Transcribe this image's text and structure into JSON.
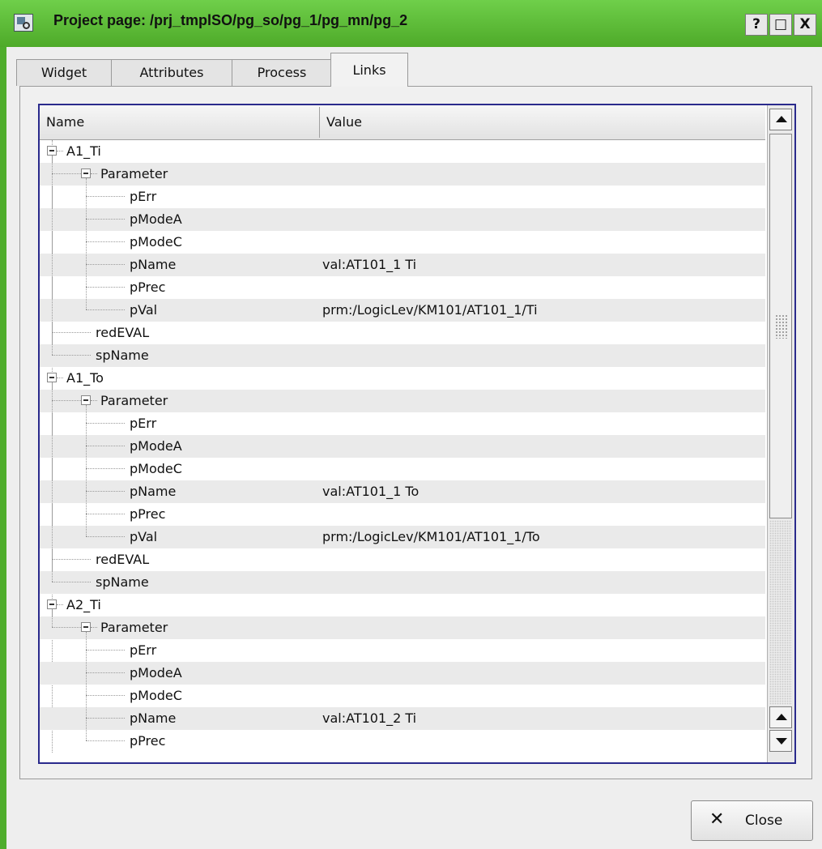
{
  "window": {
    "title": "Project page: /prj_tmplSO/pg_so/pg_1/pg_mn/pg_2"
  },
  "titlebar_buttons": [
    "?",
    "□",
    "X"
  ],
  "tabs": [
    {
      "label": "Widget"
    },
    {
      "label": "Attributes"
    },
    {
      "label": "Process"
    },
    {
      "label": "Links",
      "active": true
    }
  ],
  "tree": {
    "columns": [
      "Name",
      "Value"
    ],
    "rows": [
      {
        "name": "A1_Ti",
        "value": "",
        "level": 0,
        "kind": "node"
      },
      {
        "name": "Parameter",
        "value": "",
        "level": 1,
        "kind": "node"
      },
      {
        "name": "pErr",
        "value": "",
        "level": 2,
        "kind": "leaf"
      },
      {
        "name": "pModeA",
        "value": "",
        "level": 2,
        "kind": "leaf"
      },
      {
        "name": "pModeC",
        "value": "",
        "level": 2,
        "kind": "leaf"
      },
      {
        "name": "pName",
        "value": "val:AT101_1 Ti",
        "level": 2,
        "kind": "leaf"
      },
      {
        "name": "pPrec",
        "value": "",
        "level": 2,
        "kind": "leaf"
      },
      {
        "name": "pVal",
        "value": "prm:/LogicLev/KM101/AT101_1/Ti",
        "level": 2,
        "kind": "leaf"
      },
      {
        "name": "redEVAL",
        "value": "",
        "level": 1,
        "kind": "leaf"
      },
      {
        "name": "spName",
        "value": "",
        "level": 1,
        "kind": "leaf"
      },
      {
        "name": "A1_To",
        "value": "",
        "level": 0,
        "kind": "node"
      },
      {
        "name": "Parameter",
        "value": "",
        "level": 1,
        "kind": "node"
      },
      {
        "name": "pErr",
        "value": "",
        "level": 2,
        "kind": "leaf"
      },
      {
        "name": "pModeA",
        "value": "",
        "level": 2,
        "kind": "leaf"
      },
      {
        "name": "pModeC",
        "value": "",
        "level": 2,
        "kind": "leaf"
      },
      {
        "name": "pName",
        "value": "val:AT101_1 To",
        "level": 2,
        "kind": "leaf"
      },
      {
        "name": "pPrec",
        "value": "",
        "level": 2,
        "kind": "leaf"
      },
      {
        "name": "pVal",
        "value": "prm:/LogicLev/KM101/AT101_1/To",
        "level": 2,
        "kind": "leaf"
      },
      {
        "name": "redEVAL",
        "value": "",
        "level": 1,
        "kind": "leaf"
      },
      {
        "name": "spName",
        "value": "",
        "level": 1,
        "kind": "leaf"
      },
      {
        "name": "A2_Ti",
        "value": "",
        "level": 0,
        "kind": "node"
      },
      {
        "name": "Parameter",
        "value": "",
        "level": 1,
        "kind": "node"
      },
      {
        "name": "pErr",
        "value": "",
        "level": 2,
        "kind": "leaf"
      },
      {
        "name": "pModeA",
        "value": "",
        "level": 2,
        "kind": "leaf"
      },
      {
        "name": "pModeC",
        "value": "",
        "level": 2,
        "kind": "leaf"
      },
      {
        "name": "pName",
        "value": "val:AT101_2 Ti",
        "level": 2,
        "kind": "leaf"
      },
      {
        "name": "pPrec",
        "value": "",
        "level": 2,
        "kind": "leaf"
      }
    ]
  },
  "close_button": {
    "label": "Close"
  }
}
